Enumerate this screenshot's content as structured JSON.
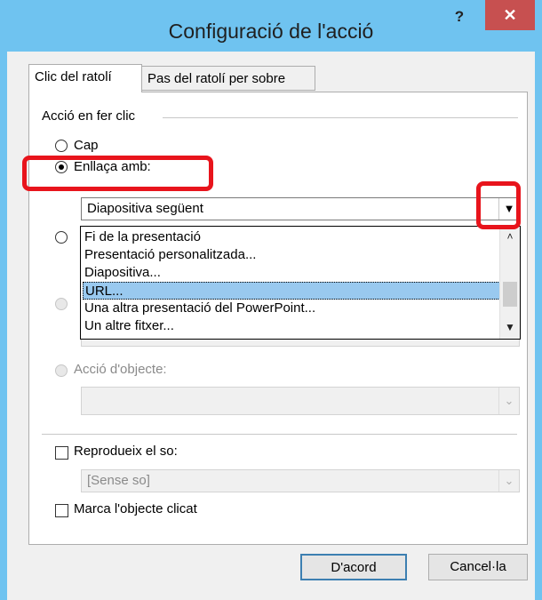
{
  "window": {
    "title": "Configuració de l'acció",
    "help_label": "?",
    "close_label": "✕"
  },
  "tabs": [
    {
      "label": "Clic del ratolí"
    },
    {
      "label": "Pas del ratolí per sobre"
    }
  ],
  "group": {
    "label": "Acció en fer clic",
    "options": {
      "none": {
        "label": "Cap",
        "checked": false
      },
      "hyperlink": {
        "label": "Enllaça amb:",
        "checked": true
      },
      "object_action": {
        "label": "Acció d'objecte:",
        "disabled": true
      }
    },
    "hyperlink_value": "Diapositiva següent",
    "dropdown_items": [
      "Fi de la presentació",
      "Presentació personalitzada...",
      "Diapositiva...",
      "URL...",
      "Una altra presentació del PowerPoint...",
      "Un altre fitxer..."
    ],
    "selected_item": "URL..."
  },
  "sound": {
    "label": "Reprodueix el so:",
    "checked": false,
    "value": "[Sense so]"
  },
  "highlight": {
    "label": "Marca l'objecte clicat",
    "checked": false
  },
  "buttons": {
    "ok": "D'acord",
    "cancel": "Cancel·la"
  },
  "icons": {
    "dropdown": "chevron-down-icon",
    "scroll_up": "chevron-up-icon",
    "scroll_down": "chevron-down-icon"
  },
  "colors": {
    "titlebar": "#6fc3f0",
    "close_button": "#c75050",
    "selection": "#99c9ef",
    "annotation": "#e8141c"
  }
}
